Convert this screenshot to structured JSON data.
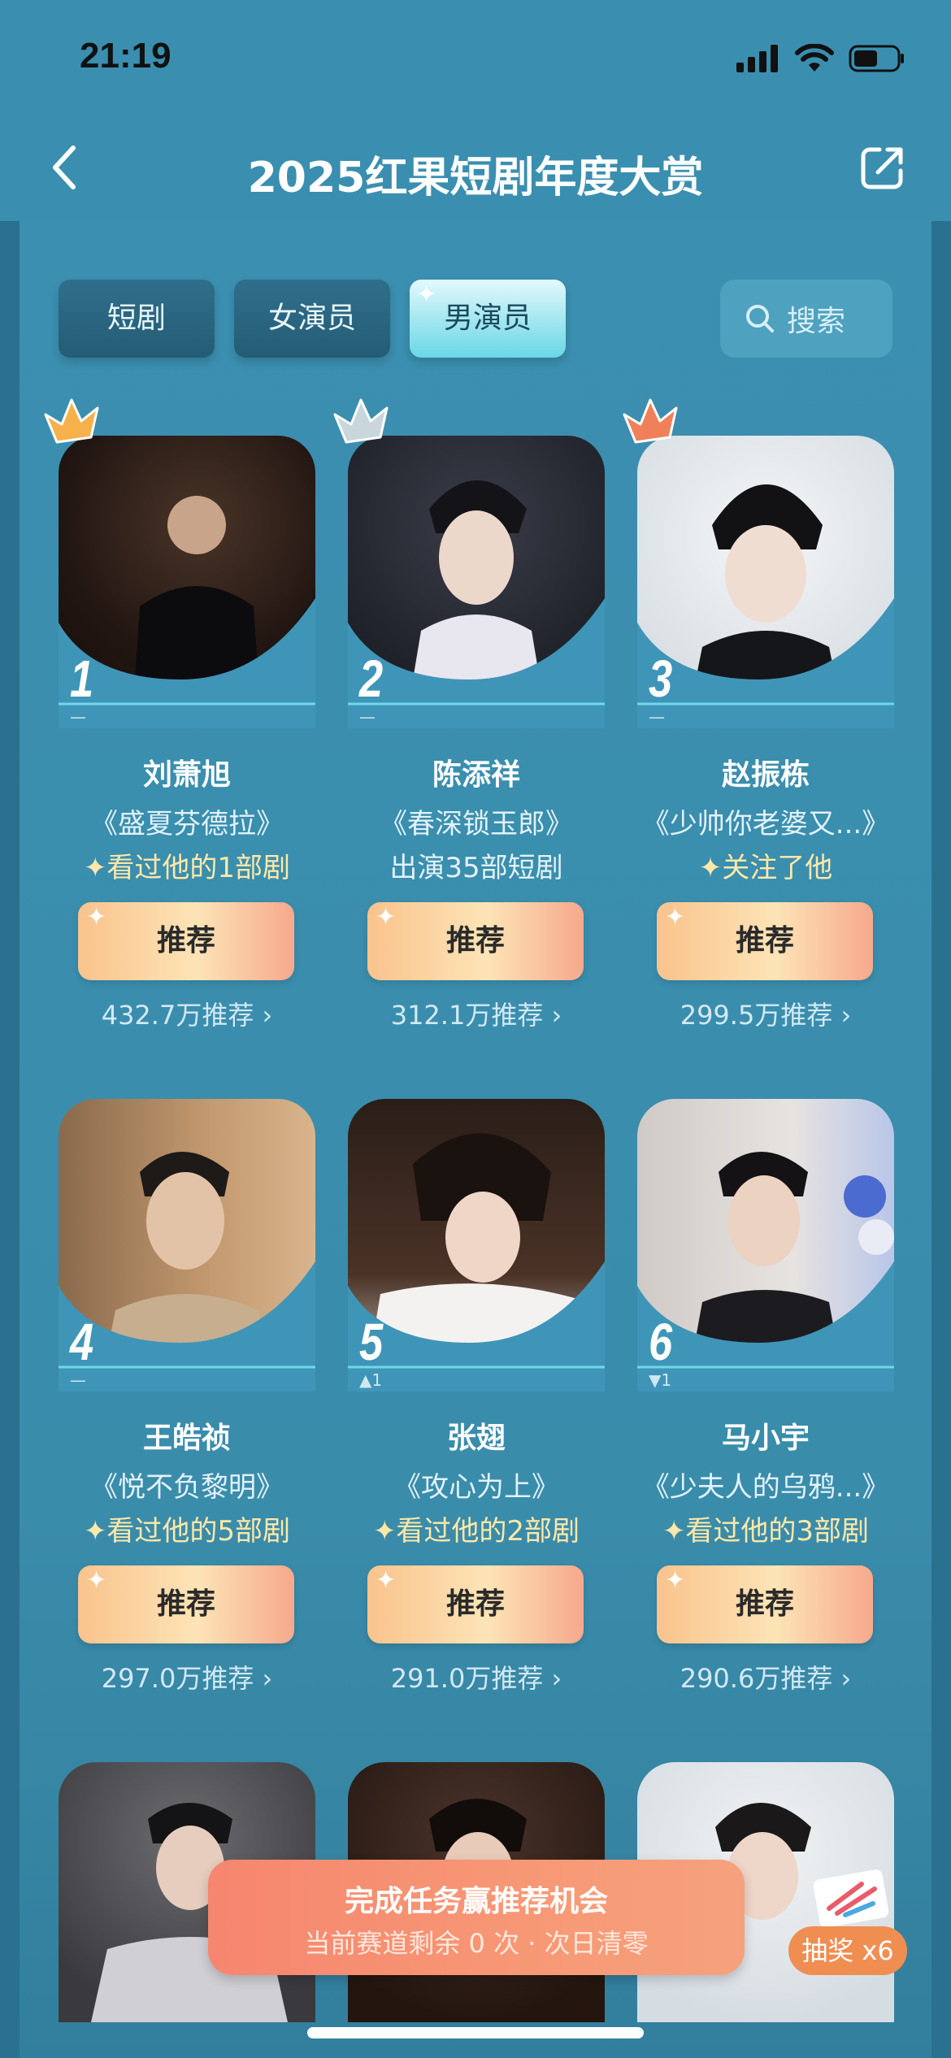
{
  "status_bar": {
    "time": "21:19"
  },
  "header": {
    "title": "2025红果短剧年度大赏"
  },
  "tabs": [
    {
      "label": "短剧",
      "active": false
    },
    {
      "label": "女演员",
      "active": false
    },
    {
      "label": "男演员",
      "active": true
    }
  ],
  "search": {
    "label": "搜索"
  },
  "actors": [
    {
      "rank": "1",
      "change": "—",
      "name": "刘萧旭",
      "drama": "《盛夏芬德拉》",
      "note": "✦看过他的1部剧",
      "note_highlight": true,
      "button": "推荐",
      "votes": "432.7万推荐 ›",
      "crown": "gold"
    },
    {
      "rank": "2",
      "change": "—",
      "name": "陈添祥",
      "drama": "《春深锁玉郎》",
      "note": "出演35部短剧",
      "note_highlight": false,
      "button": "推荐",
      "votes": "312.1万推荐 ›",
      "crown": "silver"
    },
    {
      "rank": "3",
      "change": "—",
      "name": "赵振栋",
      "drama": "《少帅你老婆又...》",
      "note": "✦关注了他",
      "note_highlight": true,
      "button": "推荐",
      "votes": "299.5万推荐 ›",
      "crown": "bronze"
    },
    {
      "rank": "4",
      "change": "—",
      "name": "王皓祯",
      "drama": "《悦不负黎明》",
      "note": "✦看过他的5部剧",
      "note_highlight": true,
      "button": "推荐",
      "votes": "297.0万推荐 ›",
      "crown": ""
    },
    {
      "rank": "5",
      "change": "▲1",
      "name": "张翅",
      "drama": "《攻心为上》",
      "note": "✦看过他的2部剧",
      "note_highlight": true,
      "button": "推荐",
      "votes": "291.0万推荐 ›",
      "crown": ""
    },
    {
      "rank": "6",
      "change": "▼1",
      "name": "马小宇",
      "drama": "《少夫人的乌鸦...》",
      "note": "✦看过他的3部剧",
      "note_highlight": true,
      "button": "推荐",
      "votes": "290.6万推荐 ›",
      "crown": ""
    }
  ],
  "task_banner": {
    "title": "完成任务赢推荐机会",
    "subtitle": "当前赛道剩余 0 次 · 次日清零"
  },
  "lottery": {
    "label": "抽奖 x6"
  },
  "colors": {
    "gold": "#f6b14b",
    "silver": "#c9d6dc",
    "bronze": "#f0805a",
    "accent": "#6ad7e6"
  }
}
